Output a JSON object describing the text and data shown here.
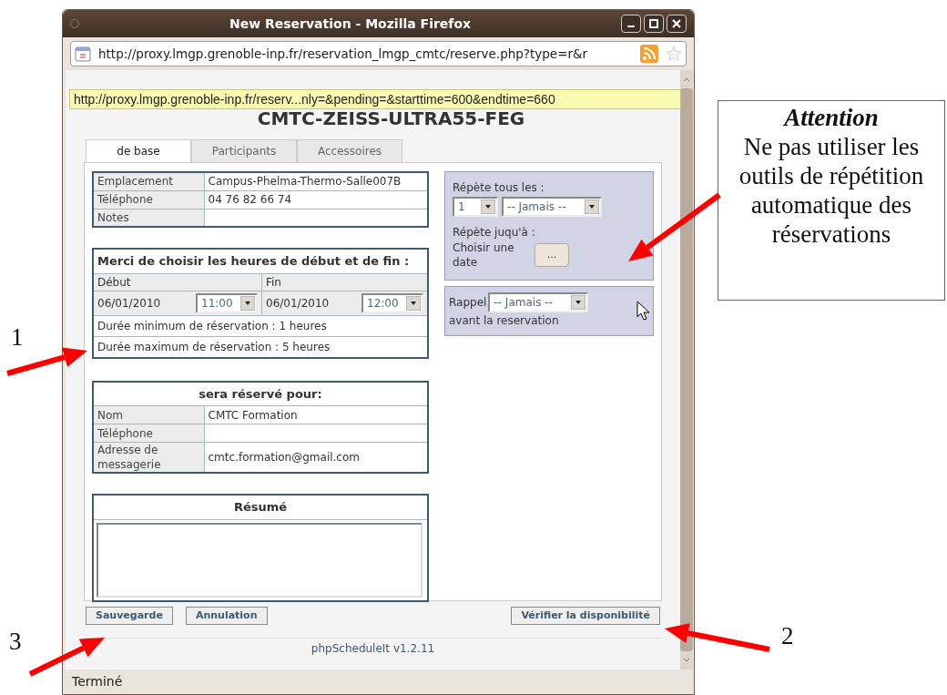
{
  "window": {
    "title": "New Reservation - Mozilla Firefox"
  },
  "address_bar": {
    "url": "http://proxy.lmgp.grenoble-inp.fr/reservation_lmgp_cmtc/reserve.php?type=r&r"
  },
  "tooltip": "http://proxy.lmgp.grenoble-inp.fr/reserv...nly=&pending=&starttime=600&endtime=660",
  "heading": "CMTC-ZEISS-ULTRA55-FEG",
  "tabs": [
    {
      "label": "de base",
      "selected": true
    },
    {
      "label": "Participants",
      "selected": false
    },
    {
      "label": "Accessoires",
      "selected": false
    }
  ],
  "resource_info": [
    {
      "label": "Emplacement",
      "value": "Campus-Phelma-Thermo-Salle007B"
    },
    {
      "label": "Téléphone",
      "value": "04 76 82 66 74"
    },
    {
      "label": "Notes"
    }
  ],
  "time_selection": {
    "title": "Merci de choisir les heures de début et de fin :",
    "start_label": "Début",
    "end_label": "Fin",
    "start_date": "06/01/2010",
    "start_time": "11:00",
    "end_date": "06/01/2010",
    "end_time": "12:00",
    "min_duration": "Durée minimum de réservation : 1 heures",
    "max_duration": "Durée maximum de réservation : 5 heures"
  },
  "repeat": {
    "every_label": "Répète tous les :",
    "interval": "1",
    "frequency": "-- Jamais --",
    "until_label": "Répète juqu'à :",
    "choose_date": "Choisir une date",
    "date_button": "..."
  },
  "reminder": {
    "label": "Rappel",
    "value": "-- Jamais --",
    "suffix": "avant la reservation"
  },
  "reserved_for": {
    "title": "sera réservé pour:",
    "rows": [
      {
        "label": "Nom",
        "value": "CMTC Formation"
      },
      {
        "label": "Téléphone"
      },
      {
        "label": "Adresse de messagerie",
        "value": "cmtc.formation@gmail.com"
      }
    ]
  },
  "summary": {
    "title": "Résumé"
  },
  "actions_left": [
    "Sauvegarde",
    "Annulation"
  ],
  "actions_right": [
    "Vérifier la disponibilité"
  ],
  "footer": "phpScheduleIt v1.2.11",
  "status_bar": "Terminé",
  "annotation": {
    "title": "Attention",
    "body": "Ne pas utiliser les outils de répétition automatique des réservations",
    "markers": [
      "1",
      "2",
      "3"
    ]
  }
}
